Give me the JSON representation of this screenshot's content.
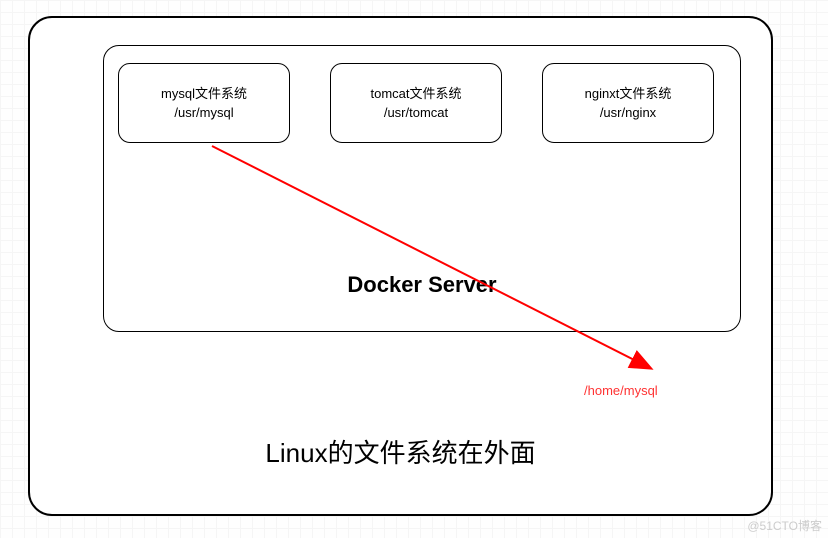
{
  "diagram": {
    "outer_label": "Linux的文件系统在外面",
    "inner_label": "Docker Server",
    "filesystem_boxes": [
      {
        "title": "mysql文件系统",
        "path": "/usr/mysql"
      },
      {
        "title": "tomcat文件系统",
        "path": "/usr/tomcat"
      },
      {
        "title": "nginxt文件系统",
        "path": "/usr/nginx"
      }
    ],
    "arrow": {
      "from": "mysql-filesystem",
      "to_label": "/home/mysql",
      "color": "#ff0000"
    },
    "watermark": "@51CTO博客"
  }
}
